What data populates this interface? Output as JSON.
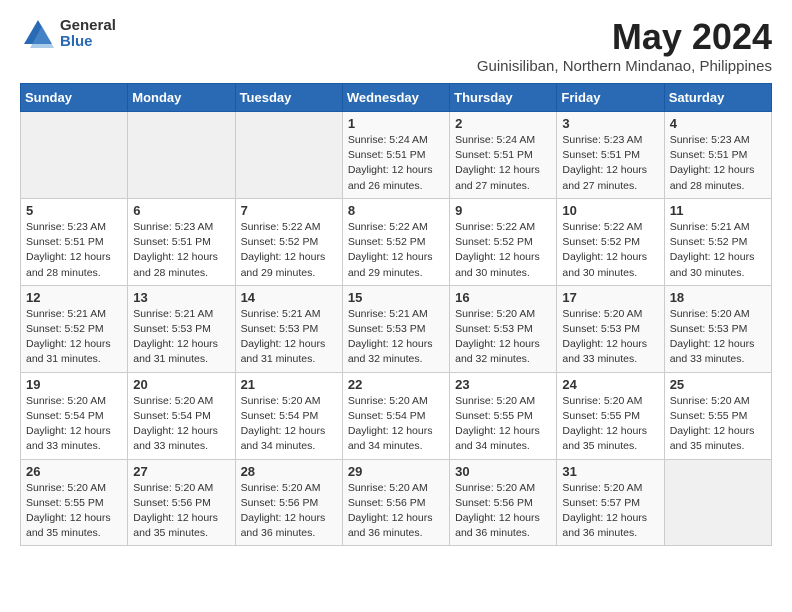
{
  "logo": {
    "general": "General",
    "blue": "Blue"
  },
  "title": "May 2024",
  "subtitle": "Guinisiliban, Northern Mindanao, Philippines",
  "days_header": [
    "Sunday",
    "Monday",
    "Tuesday",
    "Wednesday",
    "Thursday",
    "Friday",
    "Saturday"
  ],
  "weeks": [
    [
      {
        "day": "",
        "info": ""
      },
      {
        "day": "",
        "info": ""
      },
      {
        "day": "",
        "info": ""
      },
      {
        "day": "1",
        "info": "Sunrise: 5:24 AM\nSunset: 5:51 PM\nDaylight: 12 hours\nand 26 minutes."
      },
      {
        "day": "2",
        "info": "Sunrise: 5:24 AM\nSunset: 5:51 PM\nDaylight: 12 hours\nand 27 minutes."
      },
      {
        "day": "3",
        "info": "Sunrise: 5:23 AM\nSunset: 5:51 PM\nDaylight: 12 hours\nand 27 minutes."
      },
      {
        "day": "4",
        "info": "Sunrise: 5:23 AM\nSunset: 5:51 PM\nDaylight: 12 hours\nand 28 minutes."
      }
    ],
    [
      {
        "day": "5",
        "info": "Sunrise: 5:23 AM\nSunset: 5:51 PM\nDaylight: 12 hours\nand 28 minutes."
      },
      {
        "day": "6",
        "info": "Sunrise: 5:23 AM\nSunset: 5:51 PM\nDaylight: 12 hours\nand 28 minutes."
      },
      {
        "day": "7",
        "info": "Sunrise: 5:22 AM\nSunset: 5:52 PM\nDaylight: 12 hours\nand 29 minutes."
      },
      {
        "day": "8",
        "info": "Sunrise: 5:22 AM\nSunset: 5:52 PM\nDaylight: 12 hours\nand 29 minutes."
      },
      {
        "day": "9",
        "info": "Sunrise: 5:22 AM\nSunset: 5:52 PM\nDaylight: 12 hours\nand 30 minutes."
      },
      {
        "day": "10",
        "info": "Sunrise: 5:22 AM\nSunset: 5:52 PM\nDaylight: 12 hours\nand 30 minutes."
      },
      {
        "day": "11",
        "info": "Sunrise: 5:21 AM\nSunset: 5:52 PM\nDaylight: 12 hours\nand 30 minutes."
      }
    ],
    [
      {
        "day": "12",
        "info": "Sunrise: 5:21 AM\nSunset: 5:52 PM\nDaylight: 12 hours\nand 31 minutes."
      },
      {
        "day": "13",
        "info": "Sunrise: 5:21 AM\nSunset: 5:53 PM\nDaylight: 12 hours\nand 31 minutes."
      },
      {
        "day": "14",
        "info": "Sunrise: 5:21 AM\nSunset: 5:53 PM\nDaylight: 12 hours\nand 31 minutes."
      },
      {
        "day": "15",
        "info": "Sunrise: 5:21 AM\nSunset: 5:53 PM\nDaylight: 12 hours\nand 32 minutes."
      },
      {
        "day": "16",
        "info": "Sunrise: 5:20 AM\nSunset: 5:53 PM\nDaylight: 12 hours\nand 32 minutes."
      },
      {
        "day": "17",
        "info": "Sunrise: 5:20 AM\nSunset: 5:53 PM\nDaylight: 12 hours\nand 33 minutes."
      },
      {
        "day": "18",
        "info": "Sunrise: 5:20 AM\nSunset: 5:53 PM\nDaylight: 12 hours\nand 33 minutes."
      }
    ],
    [
      {
        "day": "19",
        "info": "Sunrise: 5:20 AM\nSunset: 5:54 PM\nDaylight: 12 hours\nand 33 minutes."
      },
      {
        "day": "20",
        "info": "Sunrise: 5:20 AM\nSunset: 5:54 PM\nDaylight: 12 hours\nand 33 minutes."
      },
      {
        "day": "21",
        "info": "Sunrise: 5:20 AM\nSunset: 5:54 PM\nDaylight: 12 hours\nand 34 minutes."
      },
      {
        "day": "22",
        "info": "Sunrise: 5:20 AM\nSunset: 5:54 PM\nDaylight: 12 hours\nand 34 minutes."
      },
      {
        "day": "23",
        "info": "Sunrise: 5:20 AM\nSunset: 5:55 PM\nDaylight: 12 hours\nand 34 minutes."
      },
      {
        "day": "24",
        "info": "Sunrise: 5:20 AM\nSunset: 5:55 PM\nDaylight: 12 hours\nand 35 minutes."
      },
      {
        "day": "25",
        "info": "Sunrise: 5:20 AM\nSunset: 5:55 PM\nDaylight: 12 hours\nand 35 minutes."
      }
    ],
    [
      {
        "day": "26",
        "info": "Sunrise: 5:20 AM\nSunset: 5:55 PM\nDaylight: 12 hours\nand 35 minutes."
      },
      {
        "day": "27",
        "info": "Sunrise: 5:20 AM\nSunset: 5:56 PM\nDaylight: 12 hours\nand 35 minutes."
      },
      {
        "day": "28",
        "info": "Sunrise: 5:20 AM\nSunset: 5:56 PM\nDaylight: 12 hours\nand 36 minutes."
      },
      {
        "day": "29",
        "info": "Sunrise: 5:20 AM\nSunset: 5:56 PM\nDaylight: 12 hours\nand 36 minutes."
      },
      {
        "day": "30",
        "info": "Sunrise: 5:20 AM\nSunset: 5:56 PM\nDaylight: 12 hours\nand 36 minutes."
      },
      {
        "day": "31",
        "info": "Sunrise: 5:20 AM\nSunset: 5:57 PM\nDaylight: 12 hours\nand 36 minutes."
      },
      {
        "day": "",
        "info": ""
      }
    ]
  ]
}
